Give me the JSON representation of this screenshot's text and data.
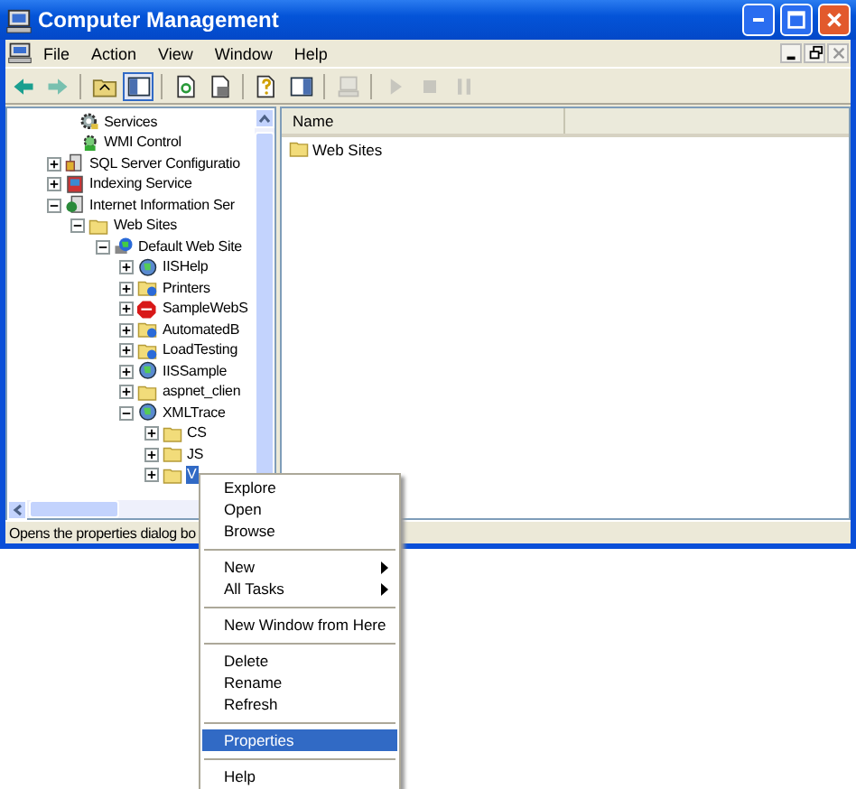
{
  "window": {
    "title": "Computer Management"
  },
  "menu_bar": [
    "File",
    "Action",
    "View",
    "Window",
    "Help"
  ],
  "toolbar": [
    {
      "kind": "back",
      "disabled": false,
      "pressed": false
    },
    {
      "kind": "forward",
      "disabled": true,
      "pressed": false
    },
    {
      "kind": "sep"
    },
    {
      "kind": "up",
      "disabled": false,
      "pressed": false
    },
    {
      "kind": "tree",
      "disabled": false,
      "pressed": true
    },
    {
      "kind": "sep"
    },
    {
      "kind": "refresh",
      "disabled": false,
      "pressed": false
    },
    {
      "kind": "export",
      "disabled": false,
      "pressed": false
    },
    {
      "kind": "sep"
    },
    {
      "kind": "help",
      "disabled": false,
      "pressed": false
    },
    {
      "kind": "pane",
      "disabled": false,
      "pressed": false
    },
    {
      "kind": "sep"
    },
    {
      "kind": "computer",
      "disabled": true,
      "pressed": false
    },
    {
      "kind": "sep"
    },
    {
      "kind": "play",
      "disabled": true,
      "pressed": false
    },
    {
      "kind": "stop",
      "disabled": true,
      "pressed": false
    },
    {
      "kind": "pause",
      "disabled": true,
      "pressed": false
    }
  ],
  "tree": [
    {
      "label": "Services",
      "kind": "gear",
      "selected": false
    },
    {
      "label": "WMI Control",
      "kind": "wmi",
      "selected": false
    },
    {
      "label": "SQL Server Configuratio",
      "kind": "sql",
      "expanded": false,
      "selected": false
    },
    {
      "label": "Indexing Service",
      "kind": "index",
      "expanded": false,
      "selected": false
    },
    {
      "label": "Internet Information Ser",
      "kind": "iis",
      "expanded": true,
      "selected": false,
      "children": [
        {
          "label": "Web Sites",
          "kind": "folder",
          "expanded": true,
          "selected": false,
          "children": [
            {
              "label": "Default Web Site",
              "kind": "site",
              "expanded": true,
              "selected": false,
              "children": [
                {
                  "label": "IISHelp",
                  "kind": "webapp",
                  "expanded": false,
                  "selected": false
                },
                {
                  "label": "Printers",
                  "kind": "webfolder",
                  "expanded": false,
                  "selected": false
                },
                {
                  "label": "SampleWebS",
                  "kind": "stopped",
                  "expanded": false,
                  "selected": false
                },
                {
                  "label": "AutomatedB",
                  "kind": "webfolder",
                  "expanded": false,
                  "selected": false
                },
                {
                  "label": "LoadTesting",
                  "kind": "webfolder",
                  "expanded": false,
                  "selected": false
                },
                {
                  "label": "IISSample",
                  "kind": "webapp",
                  "expanded": false,
                  "selected": false
                },
                {
                  "label": "aspnet_clien",
                  "kind": "folder",
                  "expanded": false,
                  "selected": false
                },
                {
                  "label": "XMLTrace",
                  "kind": "webapp",
                  "expanded": true,
                  "selected": false,
                  "children": [
                    {
                      "label": "CS",
                      "kind": "folder",
                      "expanded": false,
                      "selected": false
                    },
                    {
                      "label": "JS",
                      "kind": "folder",
                      "expanded": false,
                      "selected": false
                    },
                    {
                      "label": "V",
                      "kind": "folder",
                      "expanded": false,
                      "selected": true
                    }
                  ]
                }
              ]
            }
          ]
        }
      ]
    }
  ],
  "list": {
    "columns": [
      "Name"
    ],
    "rows": [
      {
        "name": "Web Sites",
        "kind": "folder"
      }
    ]
  },
  "status_bar": "Opens the properties dialog bo",
  "context_menu": [
    {
      "kind": "item",
      "label": "Explore",
      "selected": false
    },
    {
      "kind": "item",
      "label": "Open",
      "selected": false
    },
    {
      "kind": "item",
      "label": "Browse",
      "selected": false
    },
    {
      "kind": "separator"
    },
    {
      "kind": "submenu",
      "label": "New",
      "selected": false
    },
    {
      "kind": "submenu",
      "label": "All Tasks",
      "selected": false
    },
    {
      "kind": "separator"
    },
    {
      "kind": "item",
      "label": "New Window from Here",
      "selected": false
    },
    {
      "kind": "separator"
    },
    {
      "kind": "item",
      "label": "Delete",
      "selected": false
    },
    {
      "kind": "item",
      "label": "Rename",
      "selected": false
    },
    {
      "kind": "item",
      "label": "Refresh",
      "selected": false
    },
    {
      "kind": "separator"
    },
    {
      "kind": "item",
      "label": "Properties",
      "selected": true
    },
    {
      "kind": "separator"
    },
    {
      "kind": "item",
      "label": "Help",
      "selected": false
    }
  ]
}
